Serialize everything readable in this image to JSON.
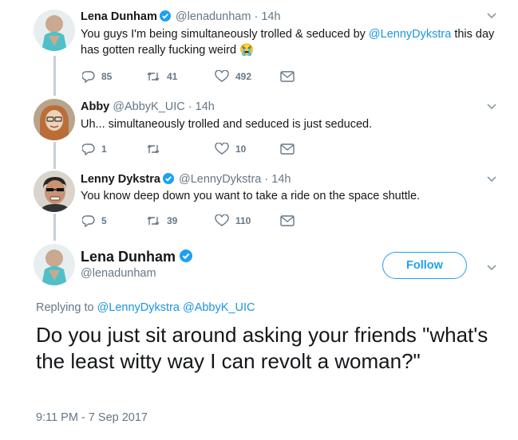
{
  "tweets": [
    {
      "name": "Lena Dunham",
      "handle": "@lenadunham",
      "dot": "·",
      "time": "14h",
      "text_before": "You guys I'm being simultaneously trolled & seduced by ",
      "mention": "@LennyDykstra",
      "text_after": " this day has gotten really fucking weird 😭",
      "replies": "85",
      "retweets": "41",
      "likes": "492",
      "verified": true
    },
    {
      "name": "Abby",
      "handle": "@AbbyK_UIC",
      "dot": "·",
      "time": "14h",
      "text": "Uh... simultaneously trolled and seduced is just seduced.",
      "replies": "1",
      "retweets": "",
      "likes": "10",
      "verified": false
    },
    {
      "name": "Lenny Dykstra",
      "handle": "@LennyDykstra",
      "dot": "·",
      "time": "14h",
      "text": "You know deep down you want to take a ride on the space shuttle.",
      "replies": "5",
      "retweets": "39",
      "likes": "110",
      "verified": true
    }
  ],
  "main_tweet": {
    "name": "Lena Dunham",
    "handle": "@lenadunham",
    "follow_label": "Follow",
    "replying_label": "Replying to",
    "replying_mentions": "@LennyDykstra @AbbyK_UIC",
    "text": "Do you just sit around asking your friends \"what's the least witty way I can revolt a woman?\"",
    "timestamp": "9:11 PM - 7 Sep 2017"
  },
  "colors": {
    "accent": "#1da1f2",
    "mention": "#1b95e0",
    "muted": "#657786",
    "thread_line": "#c4d0da",
    "verified": "#1da1f2"
  }
}
